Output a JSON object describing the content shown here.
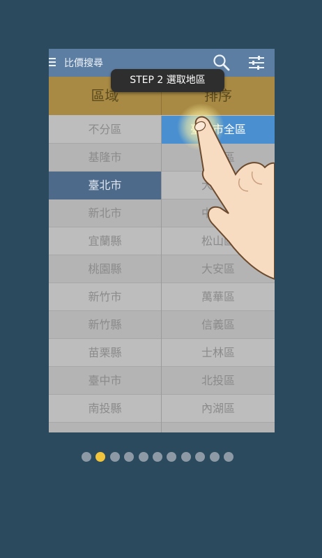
{
  "app": {
    "title": "比價搜尋"
  },
  "tip": {
    "text": "STEP 2  選取地區"
  },
  "columns": {
    "left_header": "區域",
    "right_header": "排序"
  },
  "regions": [
    {
      "label": "不分區",
      "selected": false
    },
    {
      "label": "基隆市",
      "selected": false
    },
    {
      "label": "臺北市",
      "selected": true
    },
    {
      "label": "新北市",
      "selected": false
    },
    {
      "label": "宜蘭縣",
      "selected": false
    },
    {
      "label": "桃園縣",
      "selected": false
    },
    {
      "label": "新竹市",
      "selected": false
    },
    {
      "label": "新竹縣",
      "selected": false
    },
    {
      "label": "苗栗縣",
      "selected": false
    },
    {
      "label": "臺中市",
      "selected": false
    },
    {
      "label": "南投縣",
      "selected": false
    },
    {
      "label": "",
      "selected": false
    }
  ],
  "districts": [
    {
      "label": "臺北市全區",
      "selected": true
    },
    {
      "label": "中正區",
      "selected": false
    },
    {
      "label": "大同區",
      "selected": false
    },
    {
      "label": "中山區",
      "selected": false
    },
    {
      "label": "松山區",
      "selected": false
    },
    {
      "label": "大安區",
      "selected": false
    },
    {
      "label": "萬華區",
      "selected": false
    },
    {
      "label": "信義區",
      "selected": false
    },
    {
      "label": "士林區",
      "selected": false
    },
    {
      "label": "北投區",
      "selected": false
    },
    {
      "label": "內湖區",
      "selected": false
    },
    {
      "label": "",
      "selected": false
    }
  ],
  "pager": {
    "count": 11,
    "active_index": 1
  },
  "colors": {
    "background": "#2b4a5e",
    "appbar": "#5d7ea3",
    "header": "#a88a44",
    "selected_region": "#4e6a8a",
    "selected_district": "#4a8fd0",
    "active_dot": "#f0c43c",
    "inactive_dot": "#8d9aa5"
  },
  "icons": [
    "menu-icon",
    "search-icon",
    "filter-sliders-icon",
    "pointing-hand-icon"
  ]
}
